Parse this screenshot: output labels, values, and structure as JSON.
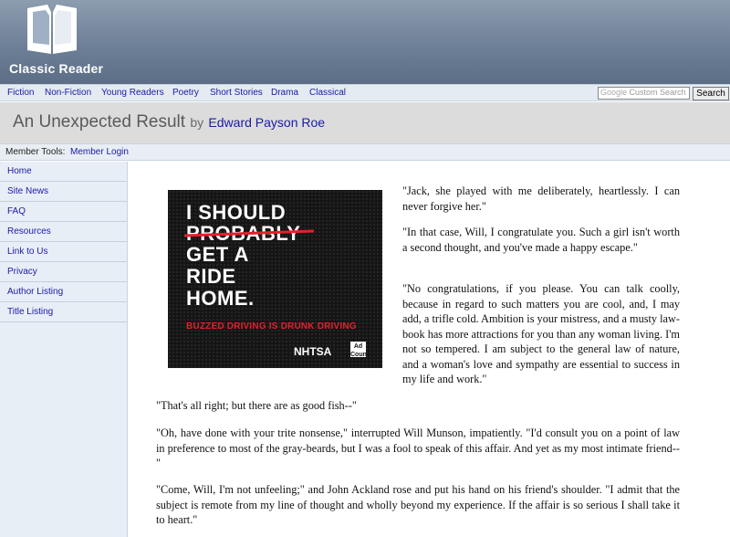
{
  "site": {
    "name": "Classic Reader",
    "logo_icon": "open-book-icon"
  },
  "categories": [
    "Fiction",
    "Non-Fiction",
    "Young Readers",
    "Poetry",
    "Short Stories",
    "Drama",
    "Classical"
  ],
  "search": {
    "placeholder": "Custom Search",
    "google_label": "Google",
    "button_label": "Search"
  },
  "page": {
    "title": "An Unexpected Result",
    "by": "by",
    "author": "Edward Payson Roe"
  },
  "member": {
    "tools_label": "Member Tools:",
    "login_label": "Member Login"
  },
  "sidebar": {
    "items": [
      {
        "label": "Home"
      },
      {
        "label": "Site News"
      },
      {
        "label": "FAQ"
      },
      {
        "label": "Resources"
      },
      {
        "label": "Link to Us"
      },
      {
        "label": "Privacy"
      },
      {
        "label": "Author Listing"
      },
      {
        "label": "Title Listing"
      }
    ]
  },
  "ad": {
    "line1": "I SHOULD",
    "line2": "PROBABLY",
    "line3": "GET A",
    "line4": "RIDE",
    "line5": "HOME.",
    "tagline": "BUZZED DRIVING IS DRUNK DRIVING",
    "brand": "NHTSA",
    "council": "Ad Council",
    "accent": "#e4202b"
  },
  "paragraphs": [
    "\"Jack, she played with me deliberately, heartlessly. I can never forgive her.\"",
    "\"In that case, Will, I congratulate you. Such a girl isn't worth a second thought, and you've made a happy escape.\"",
    "\"No congratulations, if you please. You can talk coolly, because in regard to such matters you are cool, and, I may add, a trifle cold. Ambition is your mistress, and a musty law-book has more attractions for you than any woman living. I'm not so tempered. I am subject to the general law of nature, and a woman's love and sympathy are essential to success in my life and work.\"",
    "\"That's all right; but there are as good fish--\"",
    "\"Oh, have done with your trite nonsense,\" interrupted Will Munson, impatiently. \"I'd consult you on a point of law in preference to most of the gray-beards, but I was a fool to speak of this affair. And yet as my most intimate friend--\"",
    "\"Come, Will, I'm not unfeeling;\" and John Ackland rose and put his hand on his friend's shoulder. \"I admit that the subject is remote from my line of thought and wholly beyond my experience. If the affair is so serious I shall take it to heart.\""
  ]
}
